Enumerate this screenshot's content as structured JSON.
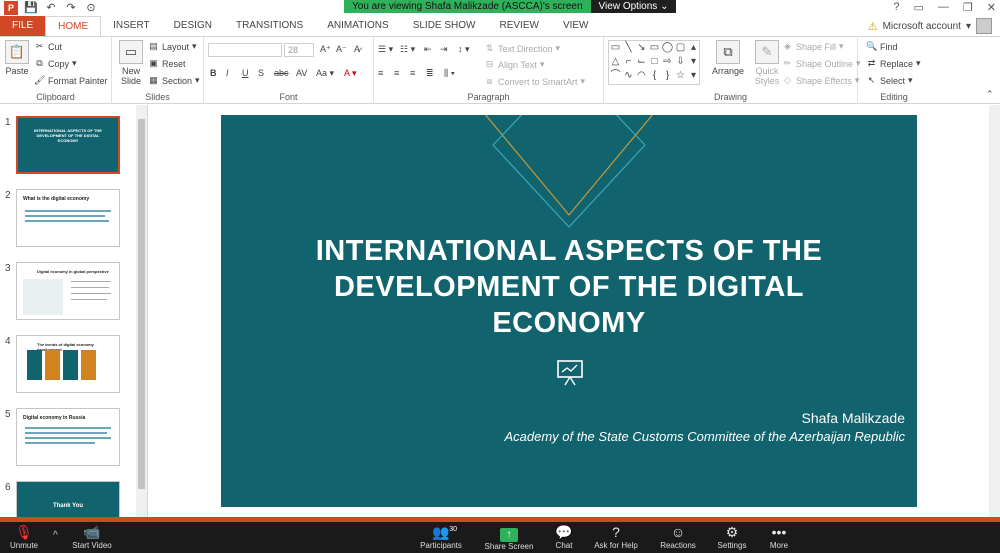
{
  "titlebar": {
    "viewing": "You are viewing Shafa Malikzade (ASCCA)'s screen",
    "view_options": "View Options",
    "help": "?",
    "ribbon_options": "▭",
    "minimize": "—",
    "restore": "❐",
    "close": "✕"
  },
  "tabs": [
    "FILE",
    "HOME",
    "INSERT",
    "DESIGN",
    "TRANSITIONS",
    "ANIMATIONS",
    "SLIDE SHOW",
    "REVIEW",
    "VIEW"
  ],
  "account": "Microsoft account",
  "ribbon": {
    "clipboard": {
      "label": "Clipboard",
      "paste": "Paste",
      "cut": "Cut",
      "copy": "Copy",
      "format_painter": "Format Painter"
    },
    "slides": {
      "label": "Slides",
      "new_slide": "New Slide",
      "layout": "Layout",
      "reset": "Reset",
      "section": "Section"
    },
    "font": {
      "label": "Font",
      "size": "28"
    },
    "paragraph": {
      "label": "Paragraph",
      "text_direction": "Text Direction",
      "align_text": "Align Text",
      "convert_smartart": "Convert to SmartArt"
    },
    "drawing": {
      "label": "Drawing",
      "arrange": "Arrange",
      "quick_styles": "Quick Styles",
      "shape_fill": "Shape Fill",
      "shape_outline": "Shape Outline",
      "shape_effects": "Shape Effects"
    },
    "editing": {
      "label": "Editing",
      "find": "Find",
      "replace": "Replace",
      "select": "Select"
    }
  },
  "thumbnails": [
    {
      "num": "1",
      "text": "INTERNATIONAL ASPECTS OF THE DEVELOPMENT OF THE DIGITAL ECONOMY"
    },
    {
      "num": "2",
      "text": "What is the digital economy"
    },
    {
      "num": "3",
      "text": "Digital economy in global perspective"
    },
    {
      "num": "4",
      "text": "The trends of digital economy development"
    },
    {
      "num": "5",
      "text": "Digital economy in Russia"
    },
    {
      "num": "6",
      "text": "Thank You"
    }
  ],
  "slide": {
    "title": "INTERNATIONAL ASPECTS OF THE DEVELOPMENT OF THE DIGITAL ECONOMY",
    "presenter": "Shafa Malikzade",
    "organization": "Academy of the State Customs Committee of the Azerbaijan Republic"
  },
  "zoom": {
    "unmute": "Unmute",
    "start_video": "Start Video",
    "participants": "Participants",
    "participants_count": "30",
    "share_screen": "Share Screen",
    "chat": "Chat",
    "ask_for_help": "Ask for Help",
    "reactions": "Reactions",
    "settings": "Settings",
    "more": "More"
  },
  "colors": {
    "accent": "#d24726",
    "slide_bg": "#11646e",
    "zoom_green": "#2fb05b"
  }
}
